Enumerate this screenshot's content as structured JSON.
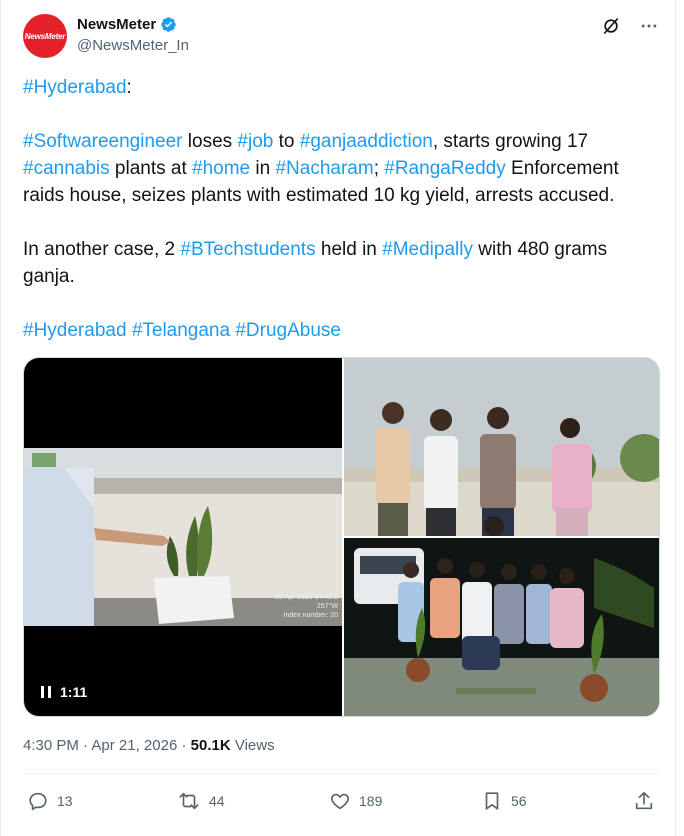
{
  "author": {
    "name": "NewsMeter",
    "handle": "@NewsMeter_In",
    "avatar_text": "NewsMeter",
    "verified_icon": "verified-badge-icon"
  },
  "post": {
    "line1": {
      "tag": "#Hyderabad",
      "rest": ":"
    },
    "para2": [
      {
        "t": "#Softwareengineer",
        "tag": true
      },
      {
        "t": " loses ",
        "tag": false
      },
      {
        "t": "#job",
        "tag": true
      },
      {
        "t": " to ",
        "tag": false
      },
      {
        "t": "#ganjaaddiction",
        "tag": true
      },
      {
        "t": ", starts growing 17 ",
        "tag": false
      },
      {
        "t": "#cannabis",
        "tag": true
      },
      {
        "t": " plants at ",
        "tag": false
      },
      {
        "t": "#home",
        "tag": true
      },
      {
        "t": " in ",
        "tag": false
      },
      {
        "t": "#Nacharam",
        "tag": true
      },
      {
        "t": "; ",
        "tag": false
      },
      {
        "t": "#RangaReddy",
        "tag": true
      },
      {
        "t": " Enforcement raids house, seizes plants with estimated 10 kg yield, arrests accused.",
        "tag": false
      }
    ],
    "para3": [
      {
        "t": "In another case, 2 ",
        "tag": false
      },
      {
        "t": "#BTechstudents",
        "tag": true
      },
      {
        "t": " held in ",
        "tag": false
      },
      {
        "t": "#Medipally",
        "tag": true
      },
      {
        "t": " with 480 grams ganja.",
        "tag": false
      }
    ],
    "para4": [
      {
        "t": "#Hyderabad",
        "tag": true
      },
      {
        "t": " ",
        "tag": false
      },
      {
        "t": "#Telangana",
        "tag": true
      },
      {
        "t": " ",
        "tag": false
      },
      {
        "t": "#DrugAbuse",
        "tag": true
      }
    ]
  },
  "media": {
    "video_duration": "1:11",
    "video_stamp_line1": "20 Apr 2026 14:42:5",
    "video_stamp_line2": "257°W",
    "video_stamp_line3": "Index number: 20"
  },
  "meta": {
    "time": "4:30 PM",
    "date": "Apr 21, 2026",
    "views_count": "50.1K",
    "views_label": "Views",
    "sep": "·"
  },
  "actions": {
    "replies": "13",
    "reposts": "44",
    "likes": "189",
    "bookmarks": "56"
  },
  "colors": {
    "link": "#1d9bf0",
    "verified": "#1d9bf0",
    "muted": "#536471"
  }
}
